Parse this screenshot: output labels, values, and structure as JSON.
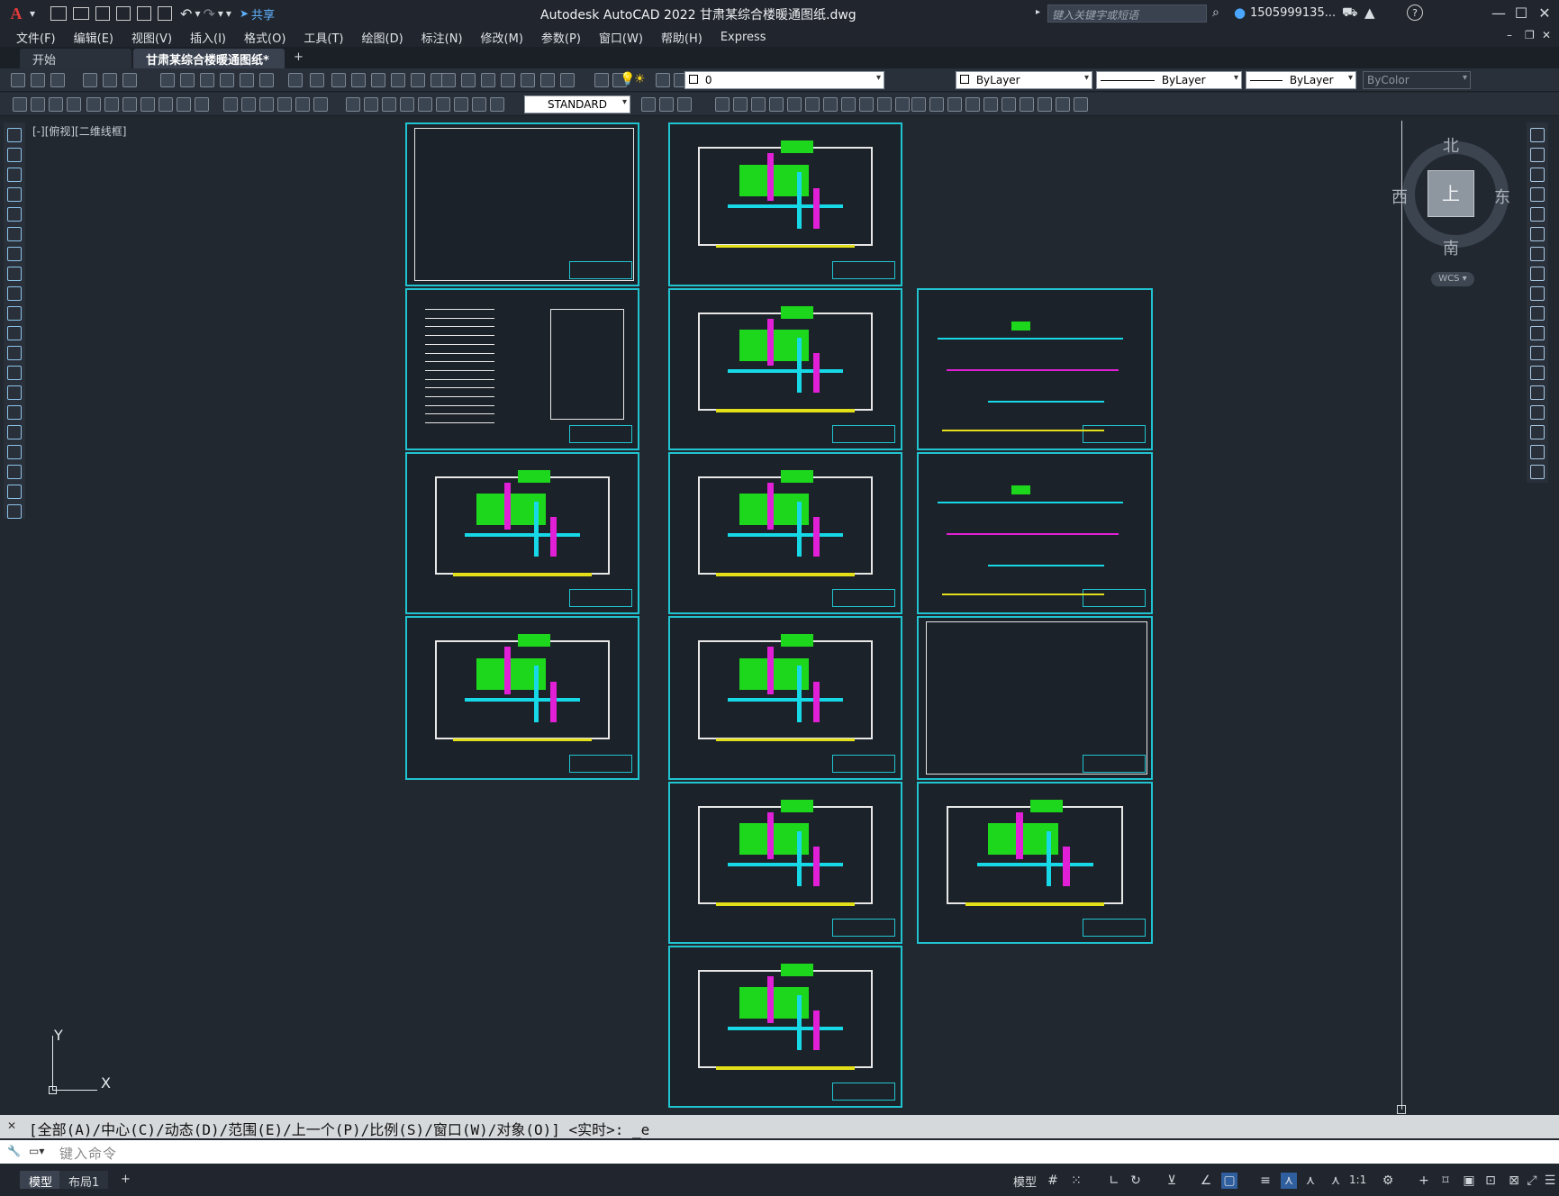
{
  "window": {
    "title": "Autodesk AutoCAD 2022    甘肃某综合楼暖通图纸.dwg",
    "app_letter": "A",
    "share_label": "共享"
  },
  "search": {
    "placeholder": "键入关键字或短语",
    "user": "1505999135..."
  },
  "menu": [
    "文件(F)",
    "编辑(E)",
    "视图(V)",
    "插入(I)",
    "格式(O)",
    "工具(T)",
    "绘图(D)",
    "标注(N)",
    "修改(M)",
    "参数(P)",
    "窗口(W)",
    "帮助(H)",
    "Express"
  ],
  "tabs": {
    "start": "开始",
    "active": "甘肃某综合楼暖通图纸*",
    "add": "+"
  },
  "layer_combo": "0",
  "color_combo": "ByLayer",
  "linetype_combo": "ByLayer",
  "lineweight_combo": "ByLayer",
  "plotstyle_combo": "ByColor",
  "textstyle_combo": "STANDARD",
  "view_label": "[-][俯视][二维线框]",
  "viewcube": {
    "north": "北",
    "south": "南",
    "east": "东",
    "west": "西",
    "face": "上",
    "wcs": "WCS"
  },
  "ucs": {
    "x": "X",
    "y": "Y"
  },
  "command": {
    "history": "[全部(A)/中心(C)/动态(D)/范围(E)/上一个(P)/比例(S)/窗口(W)/对象(O)] <实时>: _e",
    "placeholder": "键入命令"
  },
  "layout_tabs": {
    "model": "模型",
    "layout1": "布局1",
    "add": "+"
  },
  "status": {
    "model_btn": "模型",
    "scale": "1:1"
  },
  "colors": {
    "sheet_border": "#20c4d0",
    "green": "#1dd71d",
    "magenta": "#e01fd6",
    "cyan": "#16d8e6",
    "yellow": "#e3e01a",
    "background": "#212830"
  }
}
